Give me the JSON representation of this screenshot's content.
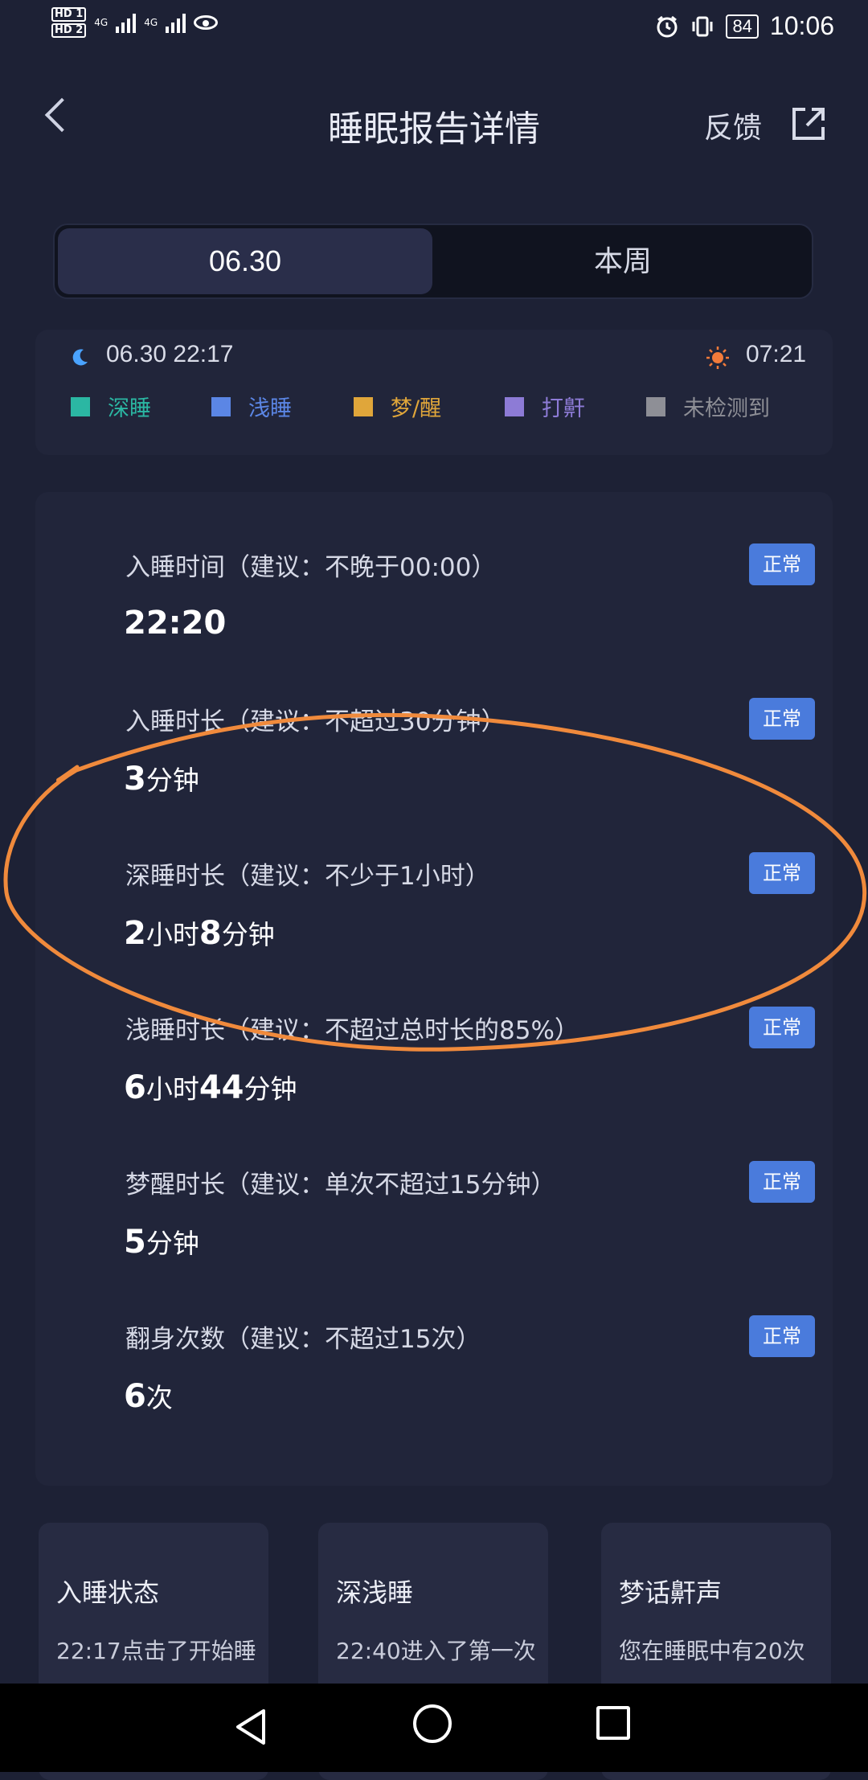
{
  "statusbar": {
    "time": "10:06",
    "battery": "84",
    "hd1": "HD 1",
    "hd2": "HD 2",
    "net1": "4G",
    "net2": "4G"
  },
  "header": {
    "title": "睡眠报告详情",
    "feedback": "反馈"
  },
  "tabs": [
    {
      "label": "06.30"
    },
    {
      "label": "本周"
    }
  ],
  "summary": {
    "sleep_start": "06.30  22:17",
    "wake_time": "07:21",
    "legend": [
      {
        "label": "深睡",
        "color": "#2bb7a3"
      },
      {
        "label": "浅睡",
        "color": "#5b86e5"
      },
      {
        "label": "梦/醒",
        "color": "#e0a63a"
      },
      {
        "label": "打鼾",
        "color": "#8d7bd6"
      },
      {
        "label": "未检测到",
        "color": "#8e8f96"
      }
    ]
  },
  "metrics": [
    {
      "label": "入睡时间（建议：不晚于00:00）",
      "value": "22:20",
      "status": "正常"
    },
    {
      "label": "入睡时长（建议：不超过30分钟）",
      "value_num": "3",
      "value_unit": "分钟",
      "status": "正常"
    },
    {
      "label": "深睡时长（建议：不少于1小时）",
      "value_h": "2",
      "value_h_unit": "小时",
      "value_m": "8",
      "value_m_unit": "分钟",
      "status": "正常"
    },
    {
      "label": "浅睡时长（建议：不超过总时长的85%）",
      "value_h": "6",
      "value_h_unit": "小时",
      "value_m": "44",
      "value_m_unit": "分钟",
      "status": "正常"
    },
    {
      "label": "梦醒时长（建议：单次不超过15分钟）",
      "value_num": "5",
      "value_unit": "分钟",
      "status": "正常"
    },
    {
      "label": "翻身次数（建议：不超过15次）",
      "value_num": "6",
      "value_unit": "次",
      "status": "正常"
    }
  ],
  "cards": [
    {
      "title": "入睡状态",
      "desc": "22:17点击了开始睡"
    },
    {
      "title": "深浅睡",
      "desc": "22:40进入了第一次"
    },
    {
      "title": "梦话鼾声",
      "desc": "您在睡眠中有20次"
    }
  ]
}
